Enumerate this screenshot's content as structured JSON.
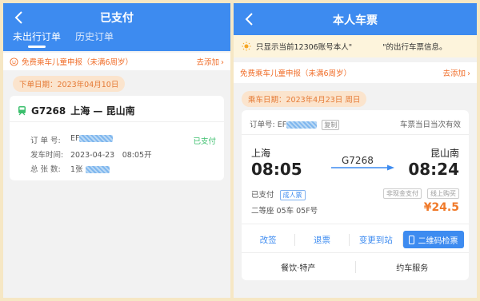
{
  "left": {
    "title": "已支付",
    "tabs": [
      "未出行订单",
      "历史订单"
    ],
    "promo_text": "免费乘车儿童申报（未满6周岁）",
    "promo_link": "去添加",
    "order_date": "下单日期：2023年04月10日",
    "train": "G7268",
    "route": "上海 — 昆山南",
    "order_no_label": "订 单 号:",
    "order_no_prefix": "EF",
    "status": "已支付",
    "depart_label": "发车时间:",
    "depart_time": "2023-04-23　08:05开",
    "count_label": "总 张 数:",
    "count": "1张"
  },
  "right": {
    "title": "本人车票",
    "notice": "只显示当前12306账号本人\"　　　　\"的出行车票信息。",
    "promo_text": "免费乘车儿童申报（未满6周岁）",
    "promo_link": "去添加",
    "ride_date": "乘车日期：2023年4月23日 周日",
    "order_no_label": "订单号:",
    "order_no_prefix": "EF",
    "copy_label": "复制",
    "validity": "车票当日当次有效",
    "from_station": "上海",
    "from_time": "08:05",
    "train": "G7268",
    "to_station": "昆山南",
    "to_time": "08:24",
    "paid_status": "已支付",
    "ticket_type": "成人票",
    "non_cash": "非现金支付",
    "online_buy": "线上购买",
    "seat": "二等座 05车 05F号",
    "price": "¥24.5",
    "actions": [
      "改签",
      "退票",
      "变更到站"
    ],
    "qr_button": "二维码检票",
    "bottom": [
      "餐饮·特产",
      "约车服务"
    ]
  },
  "colors": {
    "accent": "#3d8bf0",
    "orange": "#f06e2a",
    "green": "#3bbf6d",
    "background": "#f6e7c4"
  }
}
